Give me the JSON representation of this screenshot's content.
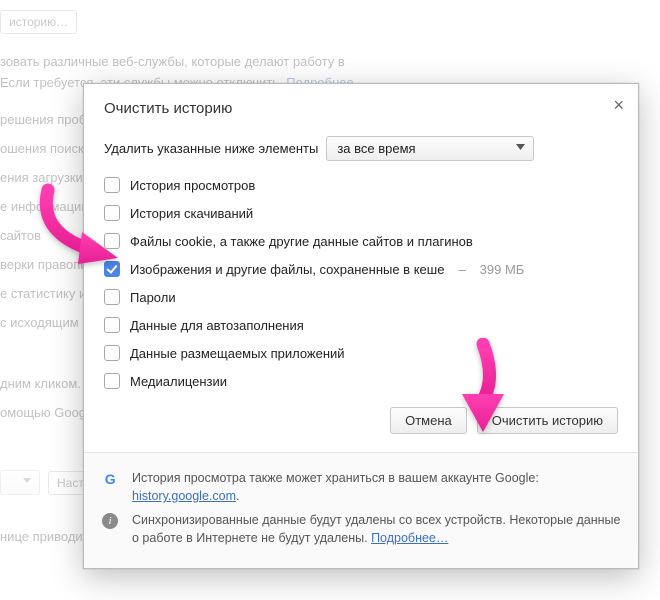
{
  "bg": {
    "tag": "историю…",
    "l1": "зовать различные веб-службы, которые делают работу в",
    "l2_a": "Если требуется, эти службы можно отключить. ",
    "l2_link": "Подробнее…",
    "s1": "решения проб",
    "s2": "ошения поиск",
    "s3": "ения загрузки",
    "s4": "е информации",
    "s5": "сайтов",
    "s6": "верки правопи",
    "s7": "е статистику и",
    "s8": "с исходящим",
    "s9": "дним кликом.",
    "s10": "омощью Googl",
    "set": "Настро",
    "bot": "нице приводит"
  },
  "dialog": {
    "title": "Очистить историю",
    "range_label": "Удалить указанные ниже элементы",
    "range_value": "за все время",
    "options": [
      {
        "label": "История просмотров",
        "checked": false
      },
      {
        "label": "История скачиваний",
        "checked": false
      },
      {
        "label": "Файлы cookie, а также другие данные сайтов и плагинов",
        "checked": false
      },
      {
        "label": "Изображения и другие файлы, сохраненные в кеше",
        "checked": true,
        "extra": "399 МБ"
      },
      {
        "label": "Пароли",
        "checked": false
      },
      {
        "label": "Данные для автозаполнения",
        "checked": false
      },
      {
        "label": "Данные размещаемых приложений",
        "checked": false
      },
      {
        "label": "Медиалицензии",
        "checked": false
      }
    ],
    "cancel": "Отмена",
    "confirm": "Очистить историю",
    "footer": {
      "google_line": "История просмотра также может храниться в вашем аккаунте Google:",
      "google_link": "history.google.com",
      "sync_line": "Синхронизированные данные будут удалены со всех устройств. Некоторые данные о работе в Интернете не будут удалены. ",
      "sync_link": "Подробнее…"
    }
  }
}
